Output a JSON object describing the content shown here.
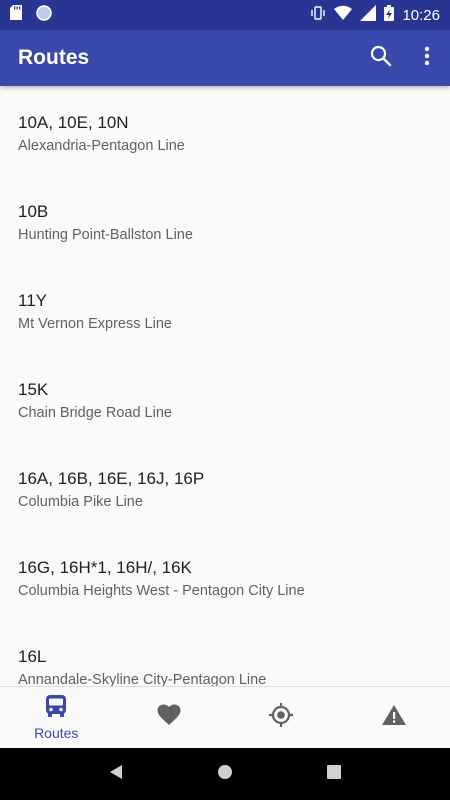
{
  "status_bar": {
    "time": "10:26"
  },
  "app_bar": {
    "title": "Routes",
    "icons": [
      "search-icon",
      "more-vert-icon"
    ]
  },
  "routes": [
    {
      "name": "10A, 10E, 10N",
      "description": "Alexandria-Pentagon Line"
    },
    {
      "name": "10B",
      "description": "Hunting Point-Ballston Line"
    },
    {
      "name": "11Y",
      "description": "Mt Vernon Express Line"
    },
    {
      "name": "15K",
      "description": "Chain Bridge Road Line"
    },
    {
      "name": "16A, 16B, 16E, 16J, 16P",
      "description": "Columbia Pike Line"
    },
    {
      "name": "16G, 16H*1, 16H/, 16K",
      "description": "Columbia Heights West - Pentagon City Line"
    },
    {
      "name": "16L",
      "description": "Annandale-Skyline City-Pentagon Line"
    }
  ],
  "bottom_nav": {
    "items": [
      {
        "icon": "bus-icon",
        "label": "Routes",
        "active": true
      },
      {
        "icon": "heart-icon",
        "label": "",
        "active": false
      },
      {
        "icon": "location-icon",
        "label": "",
        "active": false
      },
      {
        "icon": "warning-icon",
        "label": "",
        "active": false
      }
    ]
  },
  "colors": {
    "primary": "#3949ab",
    "primary_dark": "#283593",
    "active": "#3949ab",
    "inactive": "#616161"
  }
}
